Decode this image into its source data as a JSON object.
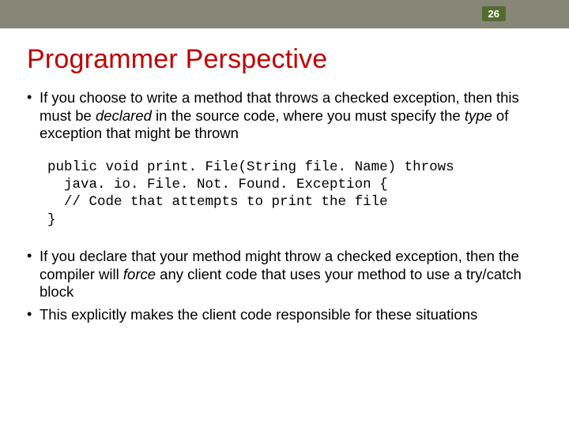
{
  "page_number": "26",
  "title": "Programmer Perspective",
  "bullets1": [
    {
      "pre": "If you choose to write a method that throws a checked exception, then this must be ",
      "em1": "declared",
      "mid": " in the source code, where you must specify the ",
      "em2": "type",
      "post": " of exception that might be thrown"
    }
  ],
  "code": {
    "line1": "public void print. File(String file. Name) throws",
    "line2": "  java. io. File. Not. Found. Exception {",
    "line3": "  // Code that attempts to print the file",
    "line4": "}"
  },
  "bullets2": [
    {
      "pre": "If you declare that your method might throw a checked exception, then the compiler will ",
      "em1": "force",
      "post": " any client code that uses your method to use a try/catch block"
    },
    {
      "text": "This explicitly makes the client code responsible for these situations"
    }
  ]
}
